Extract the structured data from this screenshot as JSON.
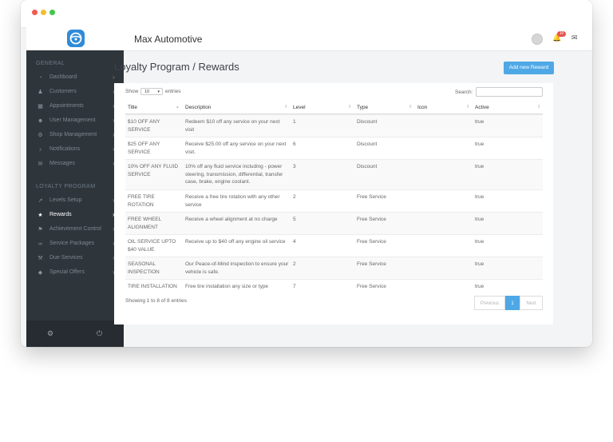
{
  "app": {
    "title": "Max Automotive",
    "notification_count": "10"
  },
  "sidebar": {
    "section_general": "GENERAL",
    "general_items": [
      {
        "label": "Dashboard",
        "icon": "dashboard-icon"
      },
      {
        "label": "Customers",
        "icon": "users-icon"
      },
      {
        "label": "Appointments",
        "icon": "calendar-icon"
      },
      {
        "label": "User Management",
        "icon": "user-icon"
      },
      {
        "label": "Shop Management",
        "icon": "gear-icon"
      },
      {
        "label": "Notifications",
        "icon": "bell-icon"
      },
      {
        "label": "Messages",
        "icon": "envelope-icon"
      }
    ],
    "section_loyalty": "LOYALTY PROGRAM",
    "loyalty_items": [
      {
        "label": "Levels Setup",
        "icon": "chart-line-icon"
      },
      {
        "label": "Rewards",
        "icon": "star-icon",
        "active": true
      },
      {
        "label": "Achievement Control",
        "icon": "flag-icon"
      },
      {
        "label": "Service Packages",
        "icon": "link-icon"
      },
      {
        "label": "Due Services",
        "icon": "wrench-icon"
      },
      {
        "label": "Special Offers",
        "icon": "tag-icon"
      }
    ]
  },
  "page": {
    "title": "Loyalty Program / Rewards",
    "add_button": "Add new Reward"
  },
  "table_controls": {
    "show": "Show",
    "page_size": "10",
    "entries": "entries",
    "search_label": "Search:"
  },
  "table": {
    "headers": [
      "Title",
      "Description",
      "Level",
      "Type",
      "Icon",
      "Active"
    ],
    "rows": [
      {
        "title": "$10 OFF ANY SERVICE",
        "description": "Redeem $10 off any service on your next visit",
        "level": "1",
        "type": "Discount",
        "icon": "",
        "active": "true"
      },
      {
        "title": "$25 OFF ANY SERVICE",
        "description": "Receive $25.00 off any service on your next visit.",
        "level": "6",
        "type": "Discount",
        "icon": "",
        "active": "true"
      },
      {
        "title": "10% OFF ANY FLUID SERVICE",
        "description": "10% off any fluid service including - power steering, transmission, differential, transfer case, brake, engine coolant.",
        "level": "3",
        "type": "Discount",
        "icon": "",
        "active": "true"
      },
      {
        "title": "FREE TIRE ROTATION",
        "description": "Receive a free tire rotation with any other service",
        "level": "2",
        "type": "Free Service",
        "icon": "",
        "active": "true"
      },
      {
        "title": "FREE WHEEL ALIGNMENT",
        "description": "Receive a wheel alignment at no charge",
        "level": "5",
        "type": "Free Service",
        "icon": "",
        "active": "true"
      },
      {
        "title": "OIL SERVICE UPTO $40 VALUE",
        "description": "Receive up to $40 off any engine oil service",
        "level": "4",
        "type": "Free Service",
        "icon": "",
        "active": "true"
      },
      {
        "title": "SEASONAL INSPECTION",
        "description": "Our Peace-of-Mind inspection to ensure your vehicle is safe.",
        "level": "2",
        "type": "Free Service",
        "icon": "",
        "active": "true"
      },
      {
        "title": "TIRE INSTALLATION",
        "description": "Free tire installation any size or type",
        "level": "7",
        "type": "Free Service",
        "icon": "",
        "active": "true"
      }
    ]
  },
  "footer": {
    "info": "Showing 1 to 8 of 8 entries",
    "previous": "Previous",
    "current_page": "1",
    "next": "Next"
  },
  "colors": {
    "accent": "#4fa8e6",
    "sidebar_bg": "#2e353b",
    "badge": "#e5534b"
  }
}
